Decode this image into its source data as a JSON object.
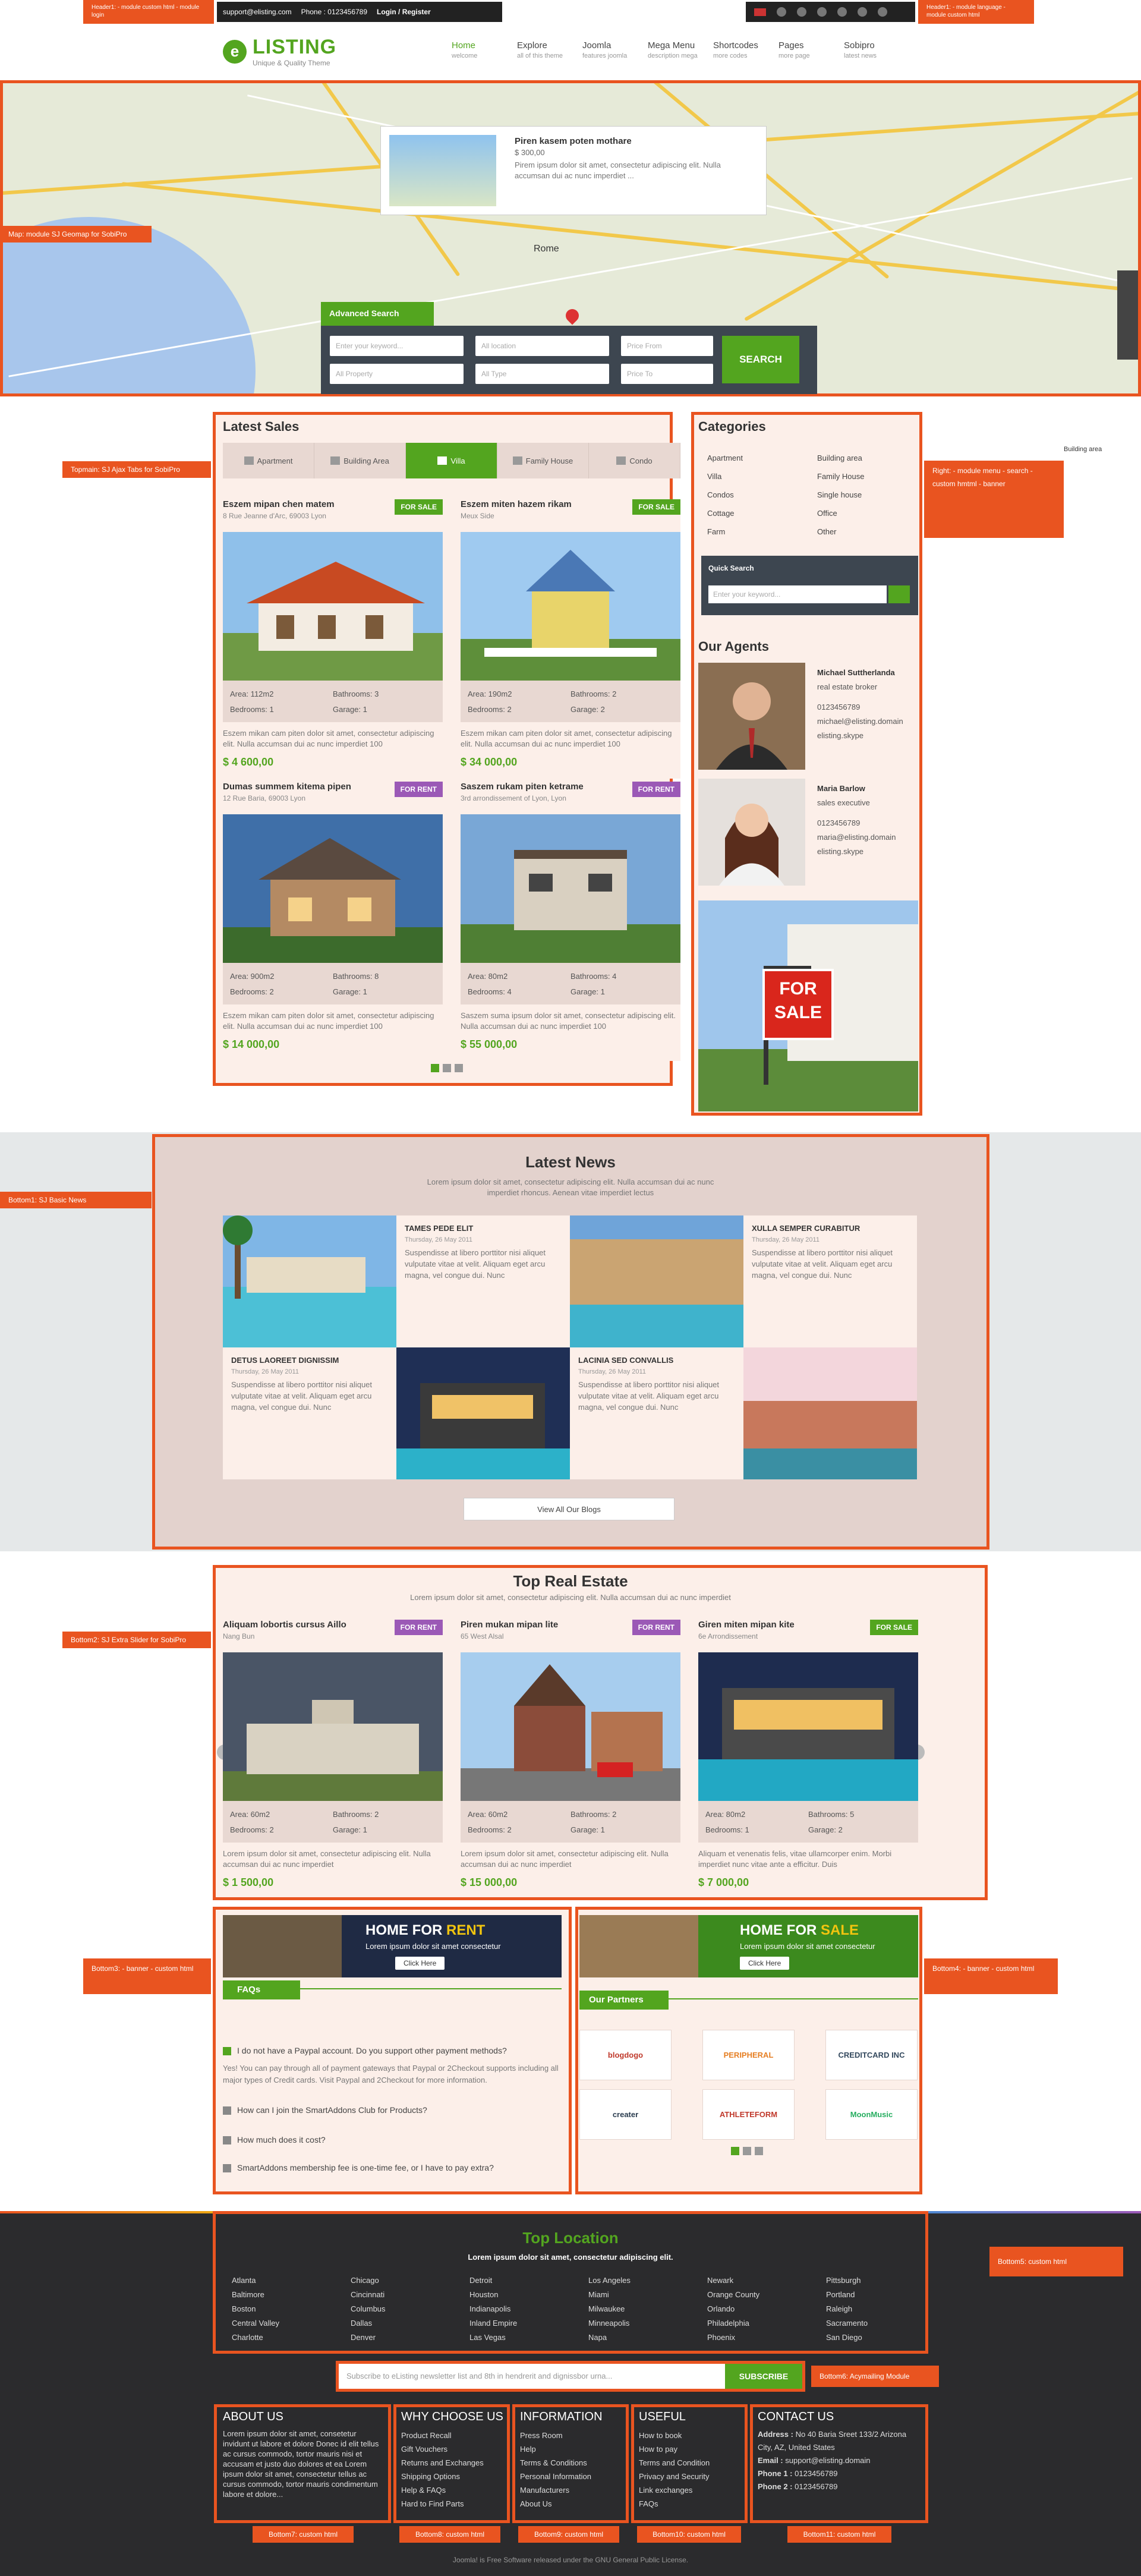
{
  "topbar": {
    "email": "support@elisting.com",
    "phone": "Phone : 0123456789",
    "login": "Login / Register"
  },
  "header": {
    "logo_name": "LISTING",
    "logo_letter": "e",
    "tagline": "Unique & Quality Theme",
    "nav": [
      {
        "label": "Home",
        "sub": "welcome"
      },
      {
        "label": "Explore",
        "sub": "all of this theme"
      },
      {
        "label": "Joomla",
        "sub": "features joomla"
      },
      {
        "label": "Mega Menu",
        "sub": "description mega"
      },
      {
        "label": "Shortcodes",
        "sub": "more codes"
      },
      {
        "label": "Pages",
        "sub": "more page"
      },
      {
        "label": "Sobipro",
        "sub": "latest news"
      }
    ]
  },
  "map": {
    "popup_title": "Piren kasem poten mothare",
    "popup_price": "$ 300,00",
    "popup_desc": "Pirem ipsum dolor sit amet, consectetur adipiscing elit. Nulla accumsan dui ac nunc imperdiet ...",
    "city": "Rome",
    "adv_tab": "Advanced Search",
    "fields": [
      "Enter your keyword...",
      "All location",
      "Price From",
      "All Property",
      "All Type",
      "Price To"
    ],
    "search_btn": "SEARCH"
  },
  "latest_sales": {
    "title": "Latest Sales",
    "tabs": [
      "Apartment",
      "Building Area",
      "Villa",
      "Family House",
      "Condo"
    ],
    "cards": [
      {
        "title": "Eszem mipan chen matem",
        "addr": "8 Rue Jeanne d'Arc, 69003 Lyon",
        "badge": "FOR SALE",
        "area": "Area: 112m2",
        "bath": "Bathrooms: 3",
        "bed": "Bedrooms: 1",
        "garage": "Garage: 1",
        "desc": "Eszem mikan cam piten dolor sit amet, consectetur adipiscing elit. Nulla accumsan dui ac nunc imperdiet 100",
        "price": "$ 4 600,00"
      },
      {
        "title": "Eszem miten hazem rikam",
        "addr": "Meux Side",
        "badge": "FOR SALE",
        "area": "Area: 190m2",
        "bath": "Bathrooms: 2",
        "bed": "Bedrooms: 2",
        "garage": "Garage: 2",
        "desc": "Eszem mikan cam piten dolor sit amet, consectetur adipiscing elit. Nulla accumsan dui ac nunc imperdiet 100",
        "price": "$ 34 000,00"
      },
      {
        "title": "Dumas summem kitema pipen",
        "addr": "12 Rue Baria, 69003 Lyon",
        "badge": "FOR RENT",
        "area": "Area: 900m2",
        "bath": "Bathrooms: 8",
        "bed": "Bedrooms: 2",
        "garage": "Garage: 1",
        "desc": "Eszem mikan cam piten dolor sit amet, consectetur adipiscing elit. Nulla accumsan dui ac nunc imperdiet 100",
        "price": "$ 14 000,00"
      },
      {
        "title": "Saszem rukam piten ketrame",
        "addr": "3rd arrondissement of Lyon, Lyon",
        "badge": "FOR RENT",
        "area": "Area: 80m2",
        "bath": "Bathrooms: 4",
        "bed": "Bedrooms: 4",
        "garage": "Garage: 1",
        "desc": "Saszem suma ipsum dolor sit amet, consectetur adipiscing elit. Nulla accumsan dui ac nunc imperdiet 100",
        "price": "$ 55 000,00"
      }
    ]
  },
  "categories": {
    "title": "Categories",
    "items": [
      "Apartment",
      "Villa",
      "Condos",
      "Cottage",
      "Farm",
      "Building area",
      "Family House",
      "Single house",
      "Office",
      "Other"
    ],
    "quick_title": "Quick Search",
    "quick_placeholder": "Enter your keyword..."
  },
  "agents": {
    "title": "Our Agents",
    "list": [
      {
        "name": "Michael Suttherlanda",
        "role": "real estate broker",
        "phone": "0123456789",
        "email": "michael@elisting.domain",
        "skype": "elisting.skype"
      },
      {
        "name": "Maria Barlow",
        "role": "sales executive",
        "phone": "0123456789",
        "email": "maria@elisting.domain",
        "skype": "elisting.skype"
      }
    ],
    "sign_top": "FOR",
    "sign_bottom": "SALE"
  },
  "news": {
    "title": "Latest News",
    "subtitle": "Lorem ipsum dolor sit amet, consectetur adipiscing elit. Nulla accumsan dui ac nunc imperdiet rhoncus. Aenean vitae imperdiet lectus",
    "items": [
      {
        "title": "TAMES PEDE ELIT",
        "date": "Thursday, 26 May 2011",
        "text": "Suspendisse at libero porttitor nisi aliquet vulputate vitae at velit. Aliquam eget arcu magna, vel congue dui. Nunc"
      },
      {
        "title": "XULLA SEMPER CURABITUR",
        "date": "Thursday, 26 May 2011",
        "text": "Suspendisse at libero porttitor nisi aliquet vulputate vitae at velit. Aliquam eget arcu magna, vel congue dui. Nunc"
      },
      {
        "title": "DETUS LAOREET DIGNISSIM",
        "date": "Thursday, 26 May 2011",
        "text": "Suspendisse at libero porttitor nisi aliquet vulputate vitae at velit. Aliquam eget arcu magna, vel congue dui. Nunc"
      },
      {
        "title": "LACINIA SED CONVALLIS",
        "date": "Thursday, 26 May 2011",
        "text": "Suspendisse at libero porttitor nisi aliquet vulputate vitae at velit. Aliquam eget arcu magna, vel congue dui. Nunc"
      }
    ],
    "view_all": "View All Our Blogs"
  },
  "top_real_estate": {
    "title": "Top Real Estate",
    "subtitle": "Lorem ipsum dolor sit amet, consectetur adipiscing elit. Nulla accumsan dui ac nunc imperdiet",
    "cards": [
      {
        "title": "Aliquam lobortis cursus Aillo",
        "addr": "Nang Bun",
        "badge": "FOR RENT",
        "area": "Area: 60m2",
        "bath": "Bathrooms: 2",
        "bed": "Bedrooms: 2",
        "garage": "Garage: 1",
        "desc": "Lorem ipsum dolor sit amet, consectetur adipiscing elit. Nulla accumsan dui ac nunc imperdiet",
        "price": "$ 1 500,00"
      },
      {
        "title": "Piren mukan mipan lite",
        "addr": "65 West Alsal",
        "badge": "FOR RENT",
        "area": "Area: 60m2",
        "bath": "Bathrooms: 2",
        "bed": "Bedrooms: 2",
        "garage": "Garage: 1",
        "desc": "Lorem ipsum dolor sit amet, consectetur adipiscing elit. Nulla accumsan dui ac nunc imperdiet",
        "price": "$ 15 000,00"
      },
      {
        "title": "Giren miten mipan kite",
        "addr": "6e Arrondissement",
        "badge": "FOR SALE",
        "area": "Area: 80m2",
        "bath": "Bathrooms: 5",
        "bed": "Bedrooms: 1",
        "garage": "Garage: 2",
        "desc": "Aliquam et venenatis felis, vitae ullamcorper enim. Morbi imperdiet nunc vitae ante a efficitur. Duis",
        "price": "$ 7 000,00"
      }
    ]
  },
  "banners": {
    "rent_h1": "HOME FOR ",
    "rent_h2": "RENT",
    "sale_h1": "HOME FOR ",
    "sale_h2": "SALE",
    "sub": "Lorem ipsum dolor sit amet consectetur",
    "btn": "Click Here"
  },
  "faqs": {
    "title": "FAQs",
    "q1": "I do not have a Paypal account. Do you support other payment methods?",
    "a1": "Yes! You can pay through all of payment gateways that Paypal or 2Checkout supports including all major types of Credit cards. Visit Paypal and 2Checkout for more information.",
    "q2": "How can I join the SmartAddons Club for Products?",
    "q3": "How much does it cost?",
    "q4": "SmartAddons membership fee is one-time fee, or I have to pay extra?"
  },
  "partners": {
    "title": "Our Partners",
    "logos": [
      "blogdogo",
      "PERIPHERAL",
      "CREDITCARD INC",
      "creater",
      "ATHLETEFORM",
      "MoonMusic"
    ]
  },
  "top_location": {
    "title": "Top Location",
    "subtitle": "Lorem ipsum dolor sit amet, consectetur adipiscing elit.",
    "cols": [
      [
        "Atlanta",
        "Baltimore",
        "Boston",
        "Central Valley",
        "Charlotte"
      ],
      [
        "Chicago",
        "Cincinnati",
        "Columbus",
        "Dallas",
        "Denver"
      ],
      [
        "Detroit",
        "Houston",
        "Indianapolis",
        "Inland Empire",
        "Las Vegas"
      ],
      [
        "Los Angeles",
        "Miami",
        "Milwaukee",
        "Minneapolis",
        "Napa"
      ],
      [
        "Newark",
        "Orange County",
        "Orlando",
        "Philadelphia",
        "Phoenix"
      ],
      [
        "Pittsburgh",
        "Portland",
        "Raleigh",
        "Sacramento",
        "San Diego"
      ]
    ]
  },
  "newsletter": {
    "placeholder": "Subscribe to eListing newsletter list and 8th in hendrerit and dignissbor urna...",
    "btn": "SUBSCRIBE"
  },
  "footer": {
    "about_title": "ABOUT US",
    "about_text": "Lorem ipsum dolor sit amet, consetetur invidunt ut labore et dolore Donec id elit tellus ac cursus commodo, tortor mauris nisi et accusam et justo duo dolores et ea Lorem ipsum dolor sit amet, consectetur tellus ac cursus commodo, tortor mauris condimentum labore et dolore...",
    "why_title": "WHY CHOOSE US",
    "why": [
      "Product Recall",
      "Gift Vouchers",
      "Returns and Exchanges",
      "Shipping Options",
      "Help & FAQs",
      "Hard to Find Parts"
    ],
    "info_title": "INFORMATION",
    "info": [
      "Press Room",
      "Help",
      "Terms & Conditions",
      "Personal Information",
      "Manufacturers",
      "About Us"
    ],
    "useful_title": "USEFUL",
    "useful": [
      "How to book",
      "How to pay",
      "Terms and Condition",
      "Privacy and Security",
      "Link exchanges",
      "FAQs"
    ],
    "contact_title": "CONTACT US",
    "address_label": "Address :",
    "address": "No 40 Baria Sreet 133/2 Arizona City, AZ, United States",
    "email_label": "Email :",
    "email": "support@elisting.domain",
    "phone1_label": "Phone 1 :",
    "phone1": "0123456789",
    "phone2_label": "Phone 2 :",
    "phone2": "0123456789",
    "copyright": "Joomla! is Free Software released under the GNU General Public License."
  },
  "module_tags": {
    "header1": "Header1: - module custom html - module login",
    "header2": "Header1: - module language - module custom html",
    "map": "Map: module SJ Geomap for SobiPro",
    "topmain": "Topmain: SJ Ajax Tabs for SobiPro",
    "right": "Right: - module menu - search - custom hmtml - banner",
    "bottom1": "Bottom1: SJ Basic News",
    "bottom2": "Bottom2: SJ Extra Slider for SobiPro",
    "bottom3": "Bottom3: - banner - custom html",
    "bottom4": "Bottom4: - banner - custom html",
    "bottom5": "Bottom5: custom html",
    "bottom6": "Bottom6: Acymailing Module",
    "bottom7": "Bottom7: custom html",
    "bottom8": "Bottom8: custom html",
    "bottom9": "Bottom9: custom html",
    "bottom10": "Bottom10: custom html",
    "bottom11": "Bottom11: custom html",
    "corner": "Building area"
  }
}
